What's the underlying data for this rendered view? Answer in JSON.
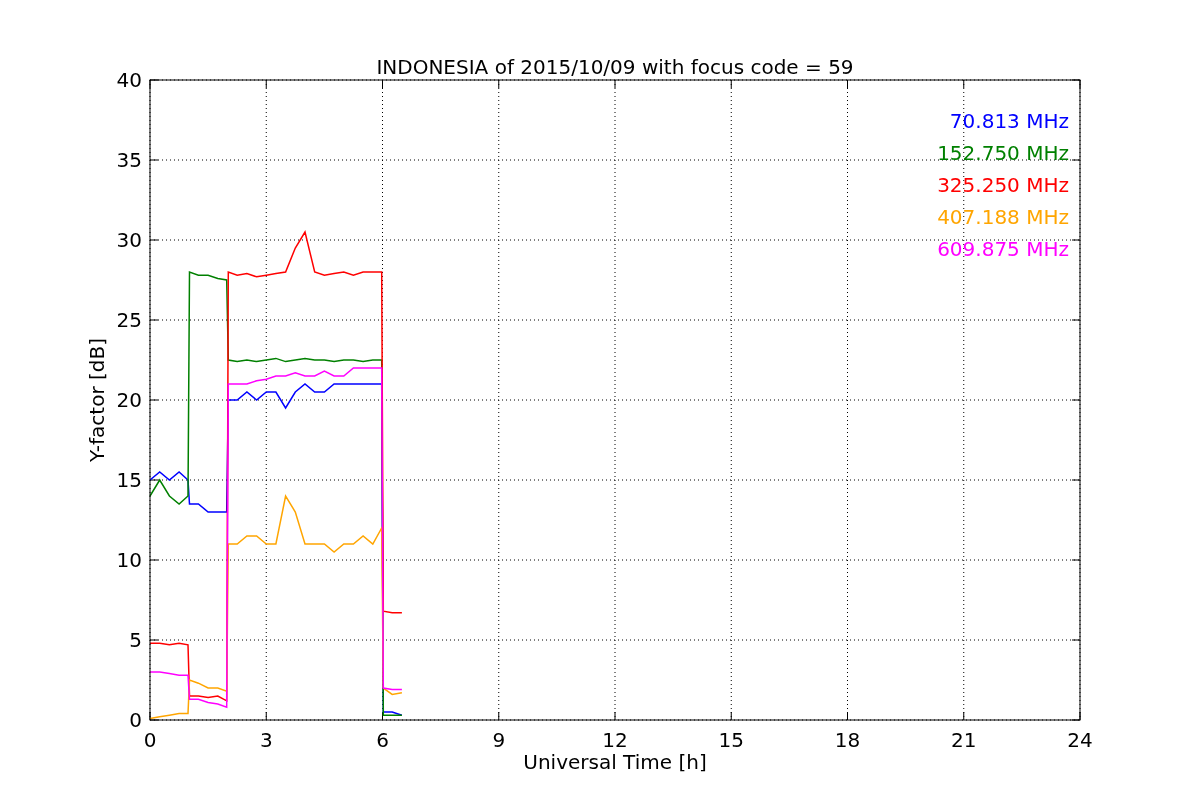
{
  "figure": {
    "chart_data": {
      "type": "line",
      "title": "INDONESIA of 2015/10/09 with focus code = 59",
      "xlabel": "Universal Time [h]",
      "ylabel": "Y-factor [dB]",
      "x": [
        0,
        0.25,
        0.5,
        0.75,
        0.98,
        1.02,
        1.25,
        1.5,
        1.75,
        1.98,
        2.02,
        2.25,
        2.5,
        2.75,
        3,
        3.25,
        3.5,
        3.75,
        4,
        4.25,
        4.5,
        4.75,
        5,
        5.25,
        5.5,
        5.75,
        5.98,
        6.02,
        6.25,
        6.5
      ],
      "series": [
        {
          "name": "70.813 MHz",
          "color": "#0000ff",
          "values": [
            15,
            15.5,
            15,
            15.5,
            15,
            13.5,
            13.5,
            13,
            13,
            13,
            20,
            20,
            20.5,
            20,
            20.5,
            20.5,
            19.5,
            20.5,
            21,
            20.5,
            20.5,
            21,
            21,
            21,
            21,
            21,
            21,
            0.5,
            0.5,
            0.3
          ]
        },
        {
          "name": "152.750 MHz",
          "color": "#008000",
          "values": [
            14,
            15,
            14,
            13.5,
            14,
            28,
            27.8,
            27.8,
            27.6,
            27.5,
            22.5,
            22.4,
            22.5,
            22.4,
            22.5,
            22.6,
            22.4,
            22.5,
            22.6,
            22.5,
            22.5,
            22.4,
            22.5,
            22.5,
            22.4,
            22.5,
            22.5,
            0.3,
            0.3,
            0.3
          ]
        },
        {
          "name": "325.250 MHz",
          "color": "#ff0000",
          "values": [
            4.8,
            4.8,
            4.7,
            4.8,
            4.7,
            1.5,
            1.5,
            1.4,
            1.5,
            1.2,
            28,
            27.8,
            27.9,
            27.7,
            27.8,
            27.9,
            28,
            29.5,
            30.5,
            28,
            27.8,
            27.9,
            28,
            27.8,
            28,
            28,
            28,
            6.8,
            6.7,
            6.7
          ]
        },
        {
          "name": "407.188 MHz",
          "color": "#ffa500",
          "values": [
            0.1,
            0.2,
            0.3,
            0.4,
            0.4,
            2.5,
            2.3,
            2,
            2,
            1.8,
            11,
            11,
            11.5,
            11.5,
            11,
            11,
            14,
            13,
            11,
            11,
            11,
            10.5,
            11,
            11,
            11.5,
            11,
            12,
            2,
            1.6,
            1.7
          ]
        },
        {
          "name": "609.875 MHz",
          "color": "#ff00ff",
          "values": [
            3,
            3,
            2.9,
            2.8,
            2.8,
            1.3,
            1.3,
            1.1,
            1,
            0.8,
            21,
            21,
            21,
            21.2,
            21.3,
            21.5,
            21.5,
            21.7,
            21.5,
            21.5,
            21.8,
            21.5,
            21.5,
            22,
            22,
            22,
            22,
            2,
            1.9,
            1.9
          ]
        }
      ],
      "xlim": [
        0,
        24
      ],
      "ylim": [
        0,
        40
      ],
      "xticks": [
        0,
        3,
        6,
        9,
        12,
        15,
        18,
        21,
        24
      ],
      "yticks": [
        0,
        5,
        10,
        15,
        20,
        25,
        30,
        35,
        40
      ],
      "grid": true
    }
  }
}
